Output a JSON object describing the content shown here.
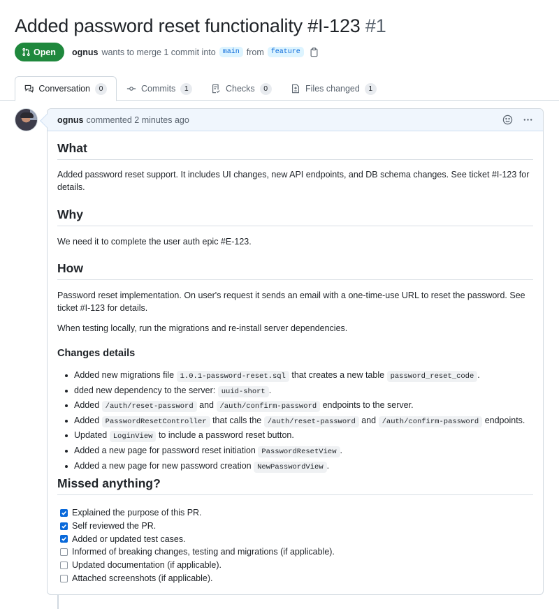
{
  "pr": {
    "title": "Added password reset functionality #I-123",
    "number": "#1",
    "state_label": "Open",
    "author": "ognus",
    "merge_text": "wants to merge 1 commit into",
    "base_branch": "main",
    "from_text": "from",
    "head_branch": "feature"
  },
  "tabs": [
    {
      "label": "Conversation",
      "count": "0",
      "icon": "comment-discussion-icon",
      "active": true
    },
    {
      "label": "Commits",
      "count": "1",
      "icon": "git-commit-icon",
      "active": false
    },
    {
      "label": "Checks",
      "count": "0",
      "icon": "checklist-icon",
      "active": false
    },
    {
      "label": "Files changed",
      "count": "1",
      "icon": "file-diff-icon",
      "active": false
    }
  ],
  "comment": {
    "author": "ognus",
    "action": "commented",
    "time": "2 minutes ago",
    "sections": {
      "what": {
        "heading": "What",
        "text": "Added password reset support. It includes UI changes, new API endpoints, and DB schema changes. See ticket #I-123 for details."
      },
      "why": {
        "heading": "Why",
        "text": "We need it to complete the user auth epic #E-123."
      },
      "how": {
        "heading": "How",
        "text1": "Password reset implementation. On user's request it sends an email with a one-time-use URL to reset the password. See ticket #I-123 for details.",
        "text2": "When testing locally, run the migrations and re-install server dependencies."
      },
      "changes": {
        "heading": "Changes details",
        "items": [
          {
            "t1": "Added new migrations file",
            "c1": "1.0.1-password-reset.sql",
            "t2": "that creates a new table",
            "c2": "password_reset_code",
            "t3": "."
          },
          {
            "t1": "dded new dependency to the server:",
            "c1": "uuid-short",
            "t2": "."
          },
          {
            "t1": "Added",
            "c1": "/auth/reset-password",
            "t2": "and",
            "c2": "/auth/confirm-password",
            "t3": "endpoints to the server."
          },
          {
            "t1": "Added",
            "c1": "PasswordResetController",
            "t2": "that calls the",
            "c2": "/auth/reset-password",
            "t3": "and",
            "c3": "/auth/confirm-password",
            "t4": "endpoints."
          },
          {
            "t1": "Updated",
            "c1": "LoginView",
            "t2": "to include a password reset button."
          },
          {
            "t1": "Added a new page for password reset initiation",
            "c1": "PasswordResetView",
            "t2": "."
          },
          {
            "t1": "Added a new page for new password creation",
            "c1": "NewPasswordView",
            "t2": "."
          }
        ]
      },
      "missed": {
        "heading": "Missed anything?",
        "tasks": [
          {
            "label": "Explained the purpose of this PR.",
            "checked": true
          },
          {
            "label": "Self reviewed the PR.",
            "checked": true
          },
          {
            "label": "Added or updated test cases.",
            "checked": true
          },
          {
            "label": "Informed of breaking changes, testing and migrations (if applicable).",
            "checked": false
          },
          {
            "label": "Updated documentation (if applicable).",
            "checked": false
          },
          {
            "label": "Attached screenshots (if applicable).",
            "checked": false
          }
        ]
      }
    }
  },
  "colors": {
    "open_green": "#1f883d",
    "accent_blue": "#0969da",
    "header_bg": "#f0f6fd"
  }
}
